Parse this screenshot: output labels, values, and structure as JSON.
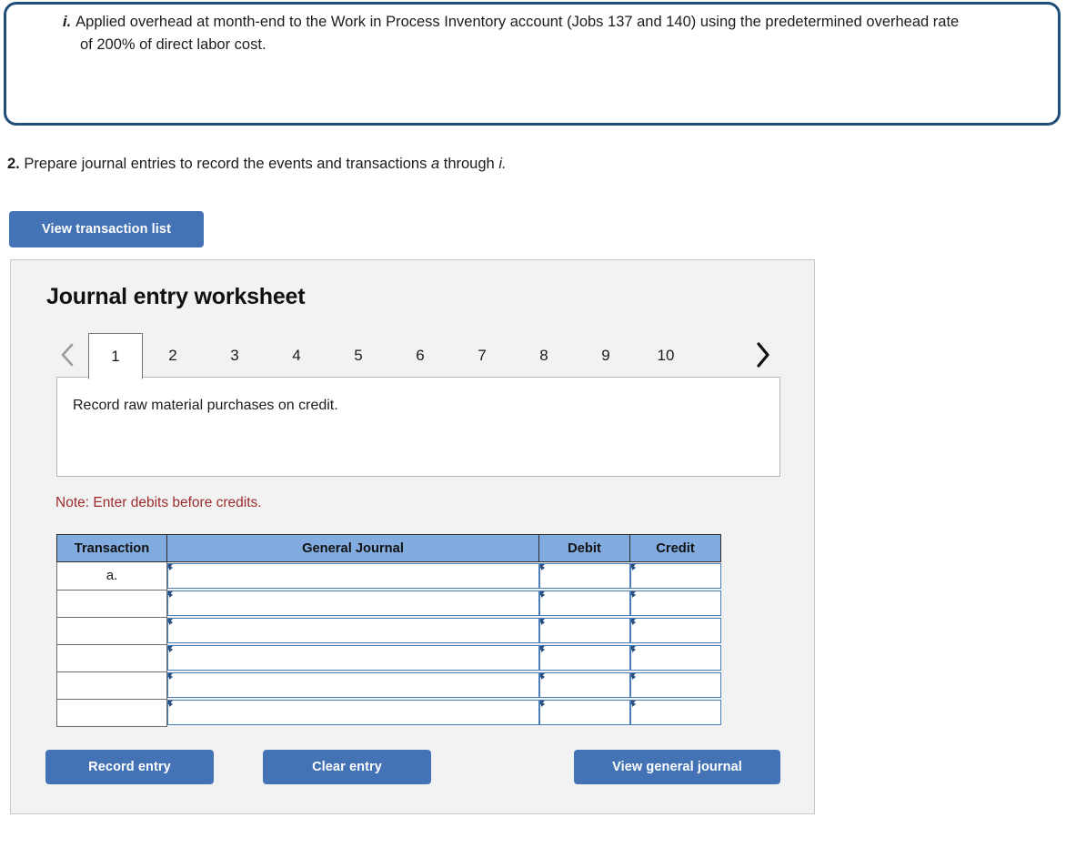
{
  "instruction_box": {
    "item_letter": "i.",
    "item_text": "Applied overhead at month-end to the Work in Process Inventory account (Jobs 137 and 140) using the predetermined overhead rate of 200% of direct labor cost."
  },
  "prompt": {
    "number": "2.",
    "text_before": "Prepare journal entries to record the events and transactions",
    "range_start": "a",
    "text_middle": "through",
    "range_end": "i."
  },
  "toolbar": {
    "view_transaction_list_label": "View transaction list"
  },
  "worksheet": {
    "title": "Journal entry worksheet",
    "prev_icon": "chevron-left-icon",
    "next_icon": "chevron-right-icon",
    "tabs": [
      {
        "label": "1",
        "active": true
      },
      {
        "label": "2",
        "active": false
      },
      {
        "label": "3",
        "active": false
      },
      {
        "label": "4",
        "active": false
      },
      {
        "label": "5",
        "active": false
      },
      {
        "label": "6",
        "active": false
      },
      {
        "label": "7",
        "active": false
      },
      {
        "label": "8",
        "active": false
      },
      {
        "label": "9",
        "active": false
      },
      {
        "label": "10",
        "active": false
      }
    ],
    "active_tab": "1",
    "description": "Record raw material purchases on credit.",
    "note": "Note: Enter debits before credits.",
    "table": {
      "headers": [
        "Transaction",
        "General Journal",
        "Debit",
        "Credit"
      ],
      "rows": [
        {
          "transaction": "a.",
          "general_journal": "",
          "debit": "",
          "credit": ""
        },
        {
          "transaction": "",
          "general_journal": "",
          "debit": "",
          "credit": ""
        },
        {
          "transaction": "",
          "general_journal": "",
          "debit": "",
          "credit": ""
        },
        {
          "transaction": "",
          "general_journal": "",
          "debit": "",
          "credit": ""
        },
        {
          "transaction": "",
          "general_journal": "",
          "debit": "",
          "credit": ""
        },
        {
          "transaction": "",
          "general_journal": "",
          "debit": "",
          "credit": ""
        }
      ]
    },
    "buttons": {
      "record_entry": "Record entry",
      "clear_entry": "Clear entry",
      "view_general_journal": "View general journal"
    }
  },
  "colors": {
    "button_blue": "#4473b5",
    "table_header_blue": "#82ace0",
    "instruction_border": "#1f4e79",
    "note_red": "#9c2c2c",
    "panel_bg": "#f2f2f2",
    "input_border_blue": "#4a7ebb"
  }
}
